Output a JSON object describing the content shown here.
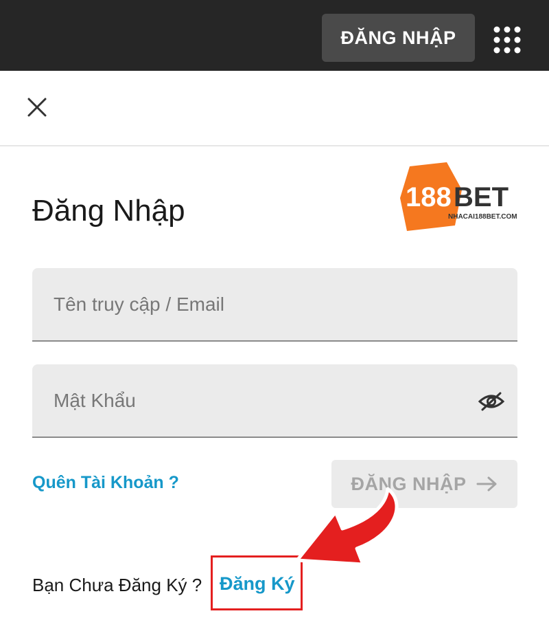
{
  "header": {
    "login_button_label": "ĐĂNG NHẬP",
    "apps_icon": "grid-dots-icon"
  },
  "close_icon": "close-icon",
  "form": {
    "title": "Đăng Nhập",
    "username_placeholder": "Tên truy cập / Email",
    "username_value": "",
    "password_placeholder": "Mật Khẩu",
    "password_value": "",
    "password_toggle_icon": "eye-slash-icon",
    "forgot_label": "Quên Tài Khoản ?",
    "submit_label": "ĐĂNG NHẬP",
    "submit_icon": "arrow-right-icon",
    "no_account_label": "Bạn Chưa Đăng Ký ?",
    "register_label": "Đăng Ký"
  },
  "logo": {
    "number": "188",
    "brand": "BET",
    "site": "NHACAI188BET.COM"
  },
  "colors": {
    "topbar": "#262626",
    "link": "#1698c9",
    "highlight": "#e41f1f",
    "logo_orange": "#f5781f"
  }
}
